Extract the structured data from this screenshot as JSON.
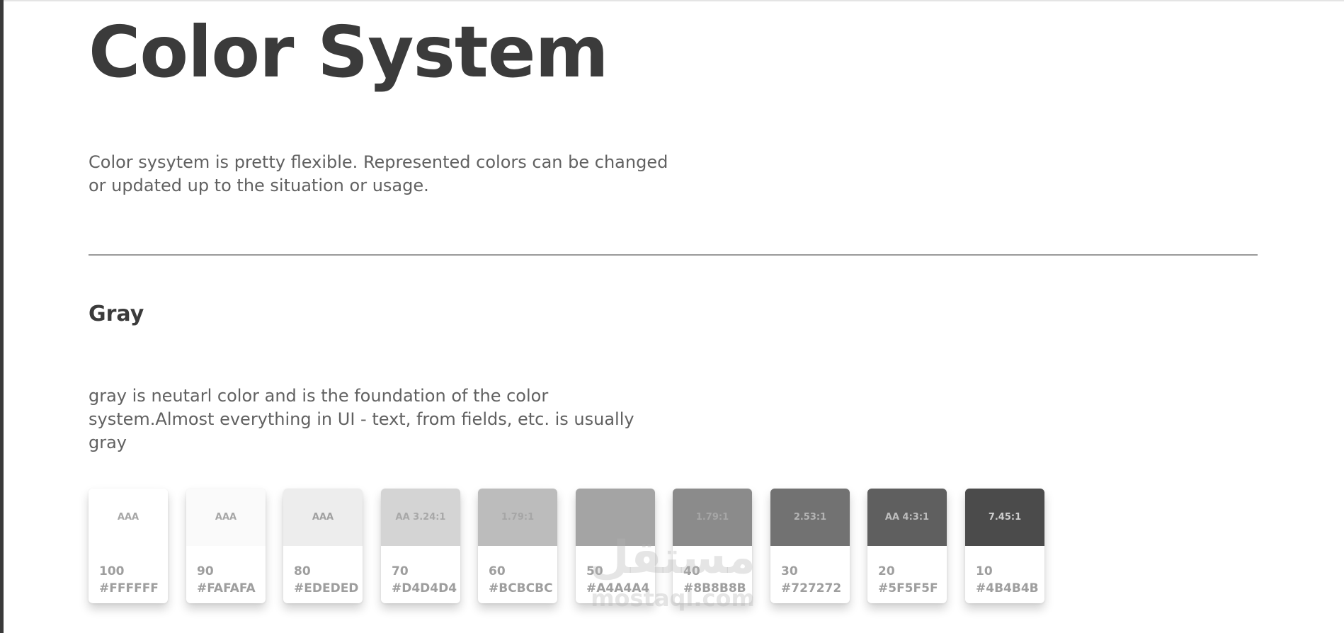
{
  "page": {
    "title": "Color System",
    "intro": "Color sysytem is pretty flexible. Represented colors can be changed or updated up to the situation or usage."
  },
  "section": {
    "title": "Gray",
    "description": "gray is neutarl color and is the foundation of the color system.Almost everything in UI - text, from fields, etc. is usually gray"
  },
  "swatches": [
    {
      "level": "100",
      "hex": "#FFFFFF",
      "contrast": "AAA",
      "color": "#FFFFFF",
      "label_color": "#a6a6a6"
    },
    {
      "level": "90",
      "hex": "#FAFAFA",
      "contrast": "AAA",
      "color": "#FAFAFA",
      "label_color": "#a6a6a6"
    },
    {
      "level": "80",
      "hex": "#EDEDED",
      "contrast": "AAA",
      "color": "#EDEDED",
      "label_color": "#a0a0a0"
    },
    {
      "level": "70",
      "hex": "#D4D4D4",
      "contrast": "AA 3.24:1",
      "color": "#D4D4D4",
      "label_color": "#a8a8a8"
    },
    {
      "level": "60",
      "hex": "#BCBCBC",
      "contrast": "1.79:1",
      "color": "#BCBCBC",
      "label_color": "#a6a6a6"
    },
    {
      "level": "50",
      "hex": "#A4A4A4",
      "contrast": "",
      "color": "#A4A4A4",
      "label_color": "#a4a4a4"
    },
    {
      "level": "40",
      "hex": "#8B8B8B",
      "contrast": "1.79:1",
      "color": "#8B8B8B",
      "label_color": "#a6a6a6"
    },
    {
      "level": "30",
      "hex": "#727272",
      "contrast": "2.53:1",
      "color": "#727272",
      "label_color": "#b4b4b4"
    },
    {
      "level": "20",
      "hex": "#5F5F5F",
      "contrast": "AA 4:3:1",
      "color": "#5F5F5F",
      "label_color": "#bdbdbd"
    },
    {
      "level": "10",
      "hex": "#4B4B4B",
      "contrast": "7.45:1",
      "color": "#4B4B4B",
      "label_color": "#cfcfcf"
    }
  ],
  "watermark": {
    "arabic": "مستقل",
    "latin": "mostaql.com"
  }
}
